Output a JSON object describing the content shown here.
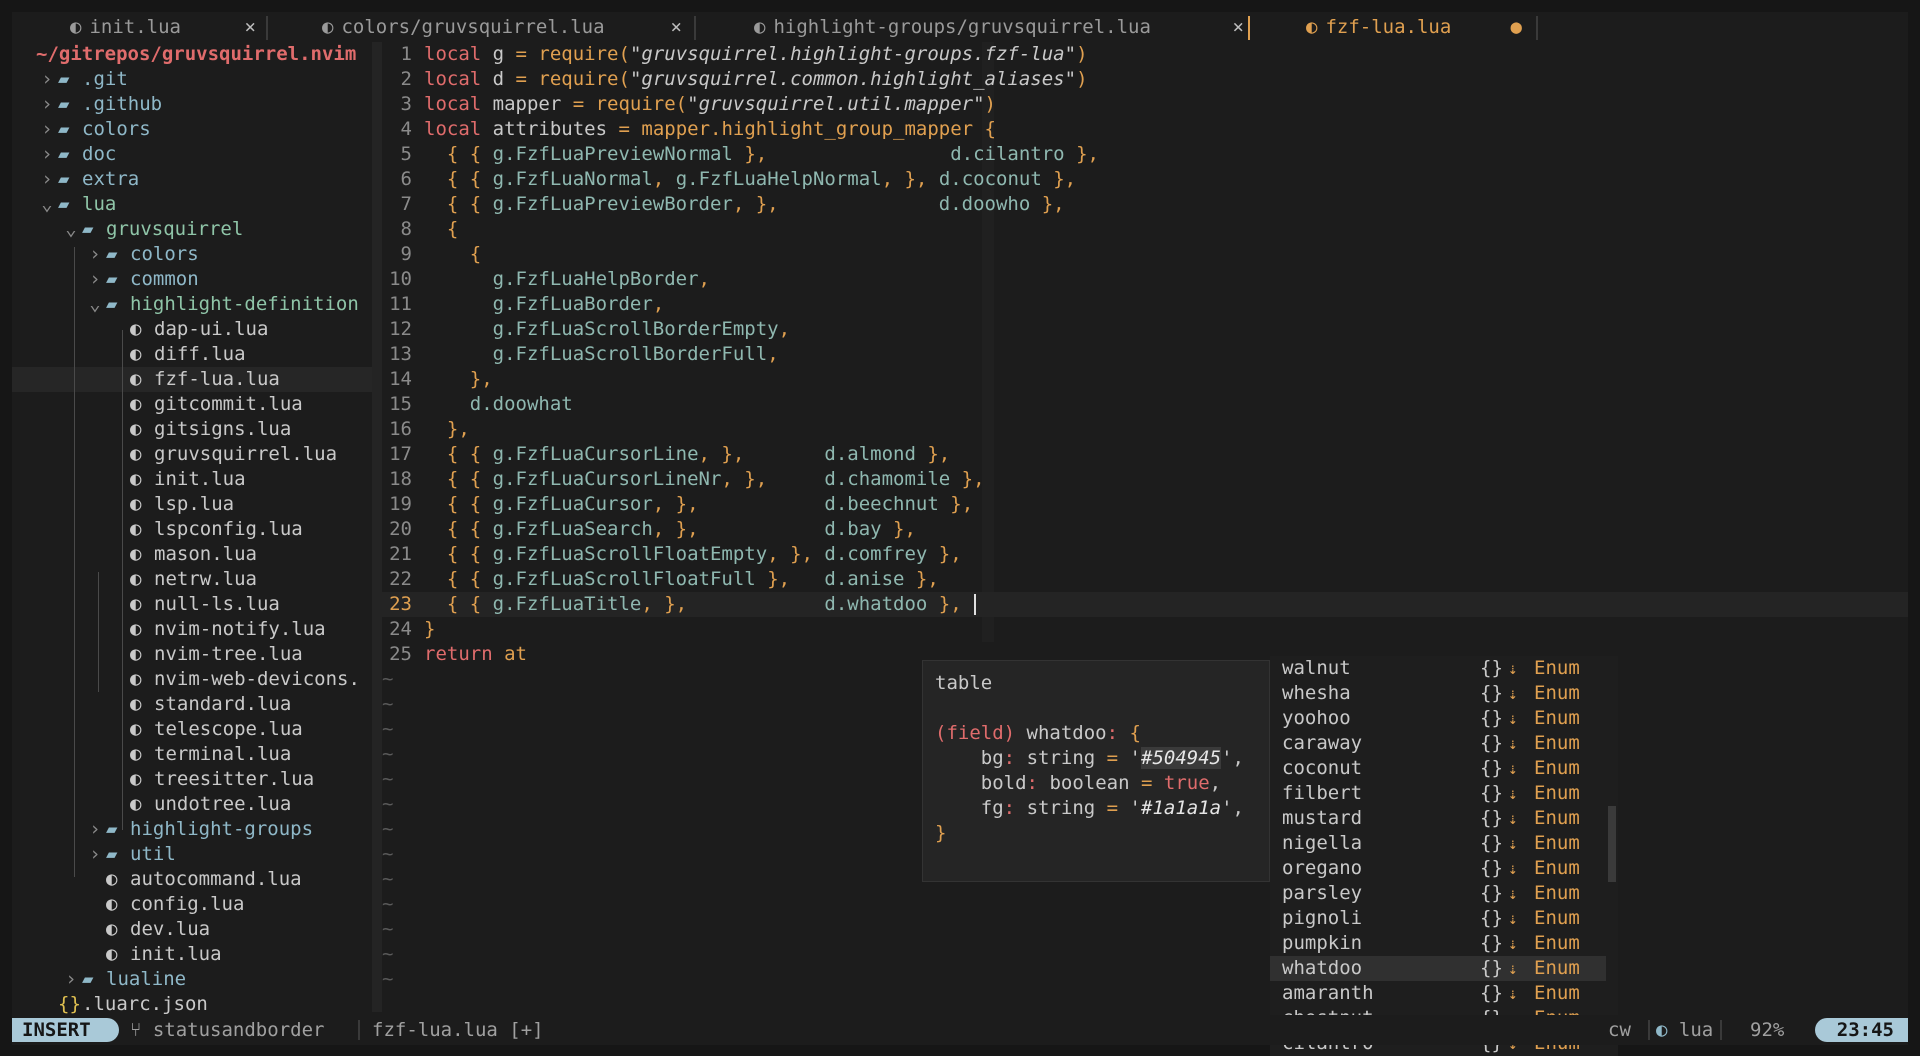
{
  "tabs": [
    {
      "label": "init.lua",
      "icon": "lua-icon",
      "close": "×"
    },
    {
      "label": "colors/gruvsquirrel.lua",
      "icon": "lua-icon",
      "close": "×"
    },
    {
      "label": "highlight-groups/gruvsquirrel.lua",
      "icon": "lua-icon",
      "close": "×"
    },
    {
      "label": "fzf-lua.lua",
      "icon": "lua-icon",
      "modified": "●"
    }
  ],
  "tree": {
    "root": "~/gitrepos/gruvsquirrel.nvim",
    "items": [
      {
        "label": ".git",
        "type": "dir",
        "arrow": "›"
      },
      {
        "label": ".github",
        "type": "dir",
        "arrow": "›"
      },
      {
        "label": "colors",
        "type": "dir",
        "arrow": "›"
      },
      {
        "label": "doc",
        "type": "dir",
        "arrow": "›"
      },
      {
        "label": "extra",
        "type": "dir",
        "arrow": "›"
      },
      {
        "label": "lua",
        "type": "dir-open",
        "arrow": "⌄"
      },
      {
        "label": "gruvsquirrel",
        "type": "dir-open",
        "arrow": "⌄"
      },
      {
        "label": "colors",
        "type": "dir",
        "arrow": "›"
      },
      {
        "label": "common",
        "type": "dir",
        "arrow": "›"
      },
      {
        "label": "highlight-definition",
        "type": "dir-open",
        "arrow": "⌄"
      },
      {
        "label": "dap-ui.lua",
        "type": "lua"
      },
      {
        "label": "diff.lua",
        "type": "lua"
      },
      {
        "label": "fzf-lua.lua",
        "type": "lua",
        "selected": true
      },
      {
        "label": "gitcommit.lua",
        "type": "lua"
      },
      {
        "label": "gitsigns.lua",
        "type": "lua"
      },
      {
        "label": "gruvsquirrel.lua",
        "type": "lua"
      },
      {
        "label": "init.lua",
        "type": "lua"
      },
      {
        "label": "lsp.lua",
        "type": "lua"
      },
      {
        "label": "lspconfig.lua",
        "type": "lua"
      },
      {
        "label": "mason.lua",
        "type": "lua"
      },
      {
        "label": "netrw.lua",
        "type": "lua"
      },
      {
        "label": "null-ls.lua",
        "type": "lua"
      },
      {
        "label": "nvim-notify.lua",
        "type": "lua"
      },
      {
        "label": "nvim-tree.lua",
        "type": "lua"
      },
      {
        "label": "nvim-web-devicons.",
        "type": "lua"
      },
      {
        "label": "standard.lua",
        "type": "lua"
      },
      {
        "label": "telescope.lua",
        "type": "lua"
      },
      {
        "label": "terminal.lua",
        "type": "lua"
      },
      {
        "label": "treesitter.lua",
        "type": "lua"
      },
      {
        "label": "undotree.lua",
        "type": "lua"
      },
      {
        "label": "highlight-groups",
        "type": "dir",
        "arrow": "›"
      },
      {
        "label": "util",
        "type": "dir",
        "arrow": "›"
      },
      {
        "label": "autocommand.lua",
        "type": "lua"
      },
      {
        "label": "config.lua",
        "type": "lua"
      },
      {
        "label": "dev.lua",
        "type": "lua"
      },
      {
        "label": "init.lua",
        "type": "lua"
      },
      {
        "label": "lualine",
        "type": "dir",
        "arrow": "›"
      },
      {
        "label": ".luarc.json",
        "type": "json"
      }
    ]
  },
  "editor": {
    "current_line": 23,
    "lines": [
      [
        [
          "kw",
          "local "
        ],
        [
          "tx",
          "g "
        ],
        [
          "op",
          "= "
        ],
        [
          "id",
          "require("
        ],
        [
          "str",
          "\"gruvsquirrel.highlight-groups.fzf-lua\""
        ],
        [
          "id",
          ")"
        ]
      ],
      [
        [
          "kw",
          "local "
        ],
        [
          "tx",
          "d "
        ],
        [
          "op",
          "= "
        ],
        [
          "id",
          "require("
        ],
        [
          "str",
          "\"gruvsquirrel.common.highlight_aliases\""
        ],
        [
          "id",
          ")"
        ]
      ],
      [
        [
          "kw",
          "local "
        ],
        [
          "tx",
          "mapper "
        ],
        [
          "op",
          "= "
        ],
        [
          "id",
          "require("
        ],
        [
          "str",
          "\"gruvsquirrel.util.mapper\""
        ],
        [
          "id",
          ")"
        ]
      ],
      [
        [
          "kw",
          "local "
        ],
        [
          "tx",
          "attributes "
        ],
        [
          "op",
          "= "
        ],
        [
          "id",
          "mapper.highlight_group_mapper {"
        ]
      ],
      [
        [
          "id",
          "  { { "
        ],
        [
          "mem",
          "g.FzfLuaPreviewNormal "
        ],
        [
          "id",
          "},"
        ],
        [
          "tx",
          "                "
        ],
        [
          "mem",
          "d.cilantro "
        ],
        [
          "id",
          "},"
        ]
      ],
      [
        [
          "id",
          "  { { "
        ],
        [
          "mem",
          "g.FzfLuaNormal"
        ],
        [
          "id",
          ", "
        ],
        [
          "mem",
          "g.FzfLuaHelpNormal"
        ],
        [
          "id",
          ", },"
        ],
        [
          "tx",
          " "
        ],
        [
          "mem",
          "d.coconut "
        ],
        [
          "id",
          "},"
        ]
      ],
      [
        [
          "id",
          "  { { "
        ],
        [
          "mem",
          "g.FzfLuaPreviewBorder"
        ],
        [
          "id",
          ", },"
        ],
        [
          "tx",
          "              "
        ],
        [
          "mem",
          "d.doowho "
        ],
        [
          "id",
          "},"
        ]
      ],
      [
        [
          "id",
          "  {"
        ]
      ],
      [
        [
          "id",
          "    {"
        ]
      ],
      [
        [
          "tx",
          "      "
        ],
        [
          "mem",
          "g.FzfLuaHelpBorder"
        ],
        [
          "id",
          ","
        ]
      ],
      [
        [
          "tx",
          "      "
        ],
        [
          "mem",
          "g.FzfLuaBorder"
        ],
        [
          "id",
          ","
        ]
      ],
      [
        [
          "tx",
          "      "
        ],
        [
          "mem",
          "g.FzfLuaScrollBorderEmpty"
        ],
        [
          "id",
          ","
        ]
      ],
      [
        [
          "tx",
          "      "
        ],
        [
          "mem",
          "g.FzfLuaScrollBorderFull"
        ],
        [
          "id",
          ","
        ]
      ],
      [
        [
          "id",
          "    },"
        ]
      ],
      [
        [
          "tx",
          "    "
        ],
        [
          "mem",
          "d.doowhat"
        ]
      ],
      [
        [
          "id",
          "  },"
        ]
      ],
      [
        [
          "id",
          "  { { "
        ],
        [
          "mem",
          "g.FzfLuaCursorLine"
        ],
        [
          "id",
          ", },"
        ],
        [
          "tx",
          "       "
        ],
        [
          "mem",
          "d.almond "
        ],
        [
          "id",
          "},"
        ]
      ],
      [
        [
          "id",
          "  { { "
        ],
        [
          "mem",
          "g.FzfLuaCursorLineNr"
        ],
        [
          "id",
          ", },"
        ],
        [
          "tx",
          "     "
        ],
        [
          "mem",
          "d.chamomile "
        ],
        [
          "id",
          "},"
        ]
      ],
      [
        [
          "id",
          "  { { "
        ],
        [
          "mem",
          "g.FzfLuaCursor"
        ],
        [
          "id",
          ", },"
        ],
        [
          "tx",
          "           "
        ],
        [
          "mem",
          "d.beechnut "
        ],
        [
          "id",
          "},"
        ]
      ],
      [
        [
          "id",
          "  { { "
        ],
        [
          "mem",
          "g.FzfLuaSearch"
        ],
        [
          "id",
          ", },"
        ],
        [
          "tx",
          "           "
        ],
        [
          "mem",
          "d.bay "
        ],
        [
          "id",
          "},"
        ]
      ],
      [
        [
          "id",
          "  { { "
        ],
        [
          "mem",
          "g.FzfLuaScrollFloatEmpty"
        ],
        [
          "id",
          ", },"
        ],
        [
          "tx",
          " "
        ],
        [
          "mem",
          "d.comfrey "
        ],
        [
          "id",
          "},"
        ]
      ],
      [
        [
          "id",
          "  { { "
        ],
        [
          "mem",
          "g.FzfLuaScrollFloatFull "
        ],
        [
          "id",
          "},"
        ],
        [
          "tx",
          "   "
        ],
        [
          "mem",
          "d.anise "
        ],
        [
          "id",
          "},"
        ]
      ],
      [
        [
          "id",
          "  { { "
        ],
        [
          "mem",
          "g.FzfLuaTitle"
        ],
        [
          "id",
          ", },"
        ],
        [
          "tx",
          "            "
        ],
        [
          "mem",
          "d.whatdoo"
        ],
        [
          "id",
          " },"
        ]
      ],
      [
        [
          "id",
          "}"
        ]
      ],
      [
        [
          "kw",
          "return "
        ],
        [
          "id",
          "at"
        ]
      ]
    ],
    "tilde": "~"
  },
  "hover": {
    "title": "table",
    "field_kw": "(field)",
    "field_name": "whatdoo",
    "brace_open": "{",
    "bg_key": "bg",
    "bg_type": "string",
    "bg_value": "#504945",
    "bold_key": "bold",
    "bold_type": "boolean",
    "bold_value": "true",
    "fg_key": "fg",
    "fg_type": "string",
    "fg_value": "#1a1a1a",
    "brace_close": "}"
  },
  "completion": {
    "selected_index": 12,
    "brace_icon": "{}",
    "kind_icon": "↓A Z",
    "kind": "Enum",
    "items": [
      "walnut",
      "whesha",
      "yoohoo",
      "caraway",
      "coconut",
      "filbert",
      "mustard",
      "nigella",
      "oregano",
      "parsley",
      "pignoli",
      "pumpkin",
      "whatdoo",
      "amaranth",
      "chestnut",
      "cilantro"
    ]
  },
  "statusline": {
    "mode": "INSERT",
    "branch_icon": "⑂",
    "branch": "statusandborder",
    "file": "fzf-lua.lua [+]",
    "cw": "cw",
    "filetype_icon": "lua-icon",
    "filetype": "lua",
    "percent": "92%",
    "clock": "23:45"
  },
  "colors": {
    "background": "#1c1c1c",
    "accent": "#e0a050",
    "keyword": "#e06c6c",
    "member": "#8fb8b0",
    "mode_bg": "#a9c9d8"
  }
}
